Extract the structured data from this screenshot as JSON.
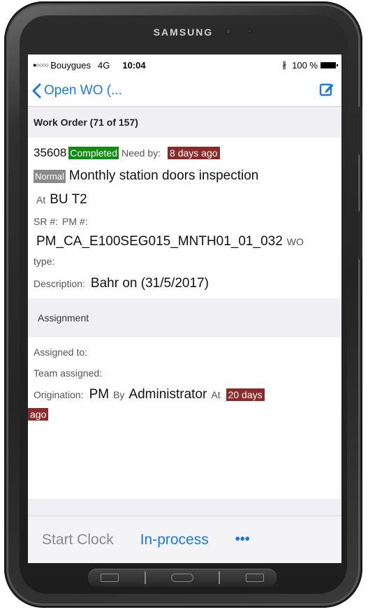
{
  "device": {
    "brand": "SAMSUNG"
  },
  "status_bar": {
    "signal": "●○○○○",
    "carrier": "Bouygues",
    "network": "4G",
    "time": "10:04",
    "bluetooth": "∦",
    "battery": "100 %"
  },
  "nav": {
    "back_label": "Open WO (...",
    "back_icon": "chevron-left-icon",
    "edit_icon": "edit-icon"
  },
  "work_order_section": {
    "title": "Work Order (71 of 157)"
  },
  "work_order": {
    "number": "35608",
    "status": "Completed",
    "need_by_label": "Need by:",
    "need_by_value": "8 days ago",
    "priority": "Normal",
    "title": "Monthly station doors inspection",
    "at_label": "At",
    "location": "BU T2",
    "sr_label": "SR #:",
    "pm_label": "PM #:",
    "pm_value": "PM_CA_E100SEG015_MNTH01_01_032",
    "wo_label_cut": "WO",
    "type_label": "type:",
    "description_label": "Description:",
    "description_value": "Bahr on (31/5/2017)"
  },
  "assignment_section": {
    "title": "Assignment"
  },
  "assignment": {
    "assigned_to_label": "Assigned to:",
    "team_label": "Team assigned:",
    "origination_label": "Origination:",
    "origination_value": "PM",
    "by_label": "By",
    "by_value": "Administrator",
    "at_label": "At",
    "at_value_line1": "20 days",
    "at_value_line2": "ago"
  },
  "footer": {
    "start_clock": "Start Clock",
    "in_process": "In-process",
    "more": "•••"
  },
  "colors": {
    "accent": "#1a7ae0",
    "completed": "#118a11",
    "overdue": "#8b2a2a",
    "priority": "#8a8a8a",
    "section_bg": "#efeff4"
  }
}
